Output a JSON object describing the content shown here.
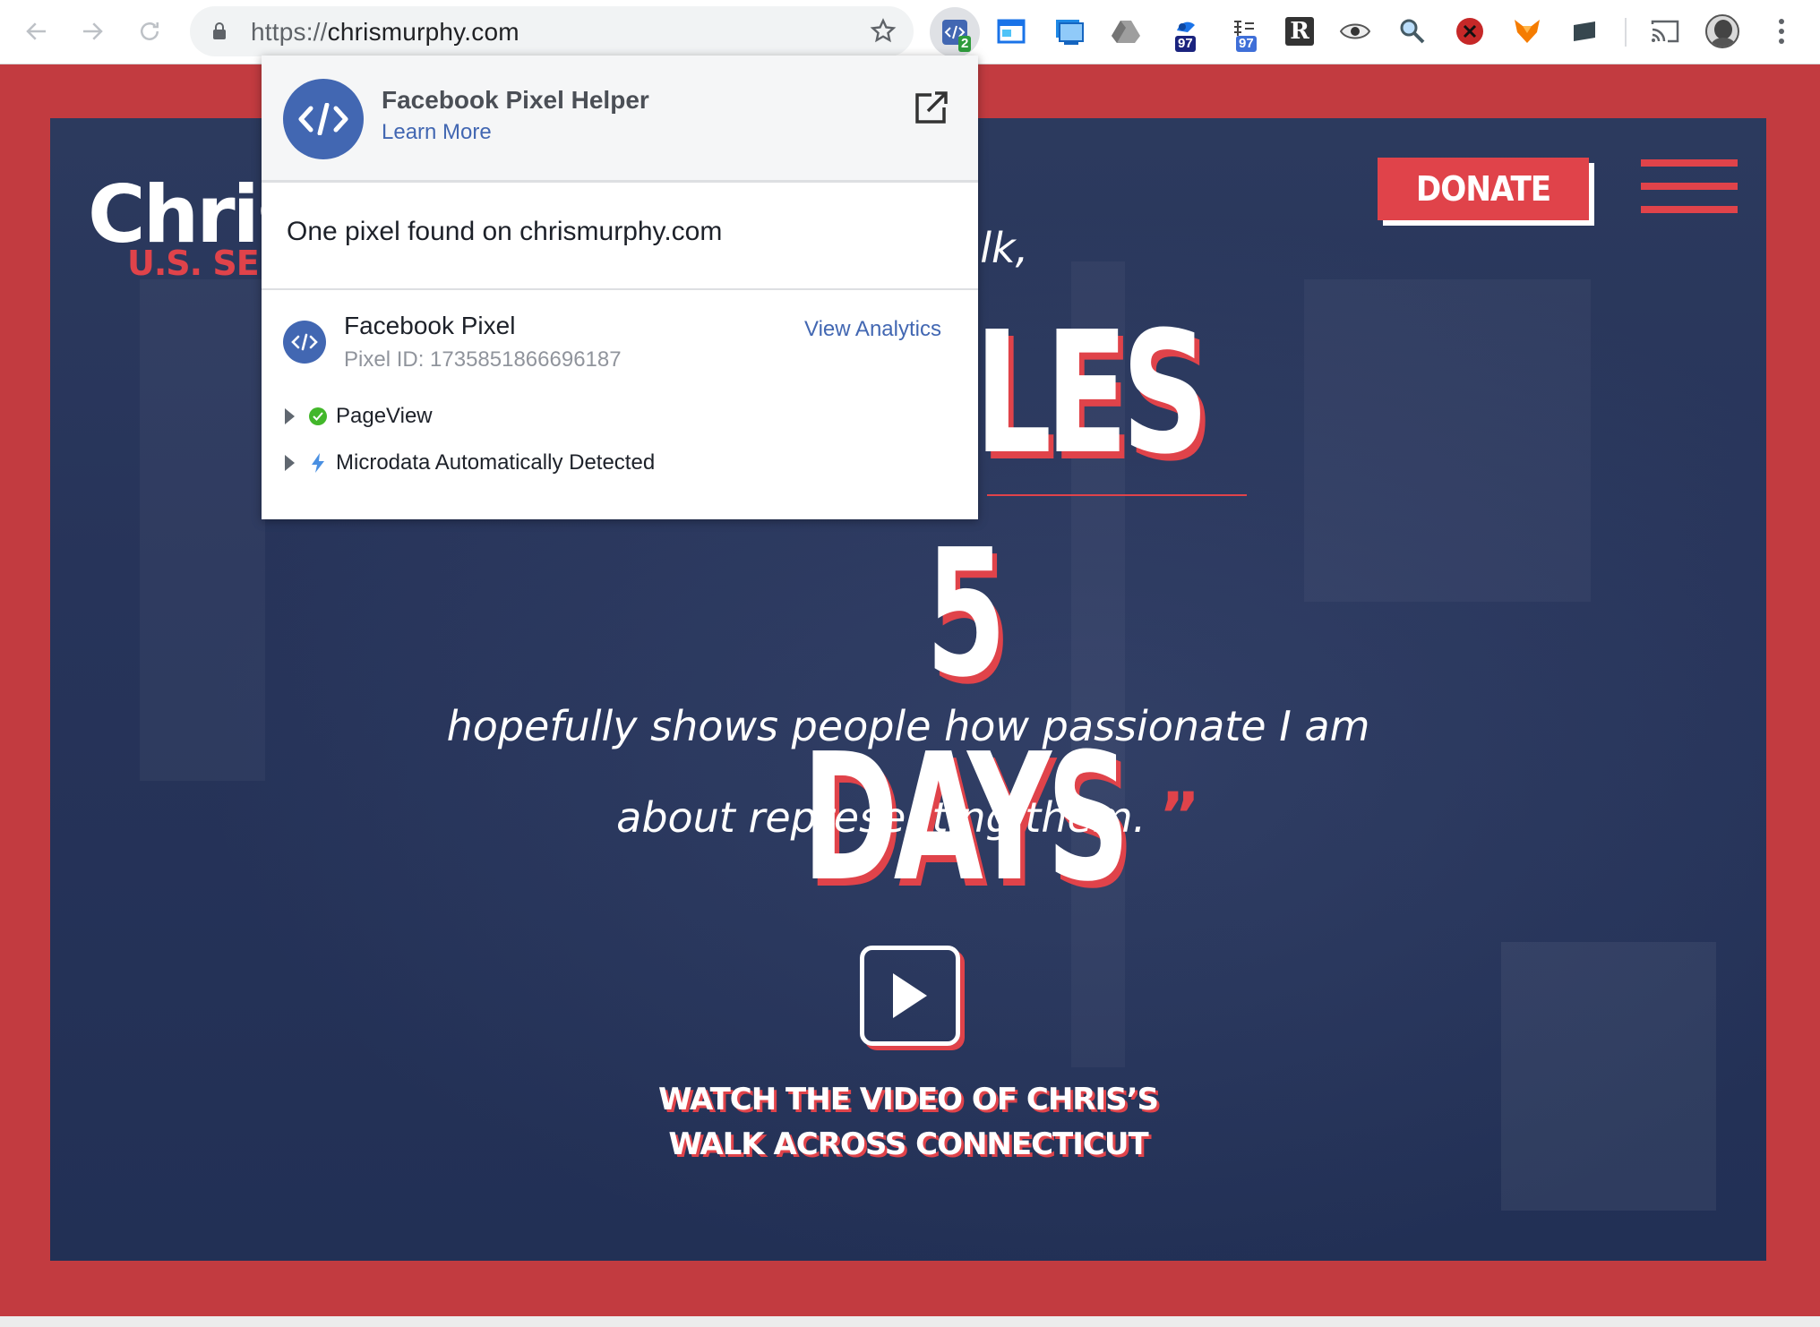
{
  "browser": {
    "url_scheme": "https://",
    "url_host": "chrismurphy.com",
    "extensions": [
      {
        "name": "facebook-pixel-helper-icon",
        "badge": "2",
        "active": true
      },
      {
        "name": "window-extension-icon"
      },
      {
        "name": "screenshot-extension-icon"
      },
      {
        "name": "drive-extension-icon"
      },
      {
        "name": "drop-extension-icon",
        "badge": "97"
      },
      {
        "name": "tree-extension-icon",
        "badge": "97"
      },
      {
        "name": "r-extension-icon",
        "label": "R"
      },
      {
        "name": "eye-extension-icon"
      },
      {
        "name": "search-bug-extension-icon"
      },
      {
        "name": "blocker-extension-icon"
      },
      {
        "name": "fox-extension-icon"
      },
      {
        "name": "screen-extension-icon"
      },
      {
        "name": "cast-icon"
      },
      {
        "name": "profile-avatar"
      }
    ]
  },
  "site": {
    "logo_name": "Chris",
    "logo_sub": "U.S. SENA",
    "donate_label": "DONATE",
    "quote_fragment": "alk,",
    "big_fragment": "LES",
    "days_text": "5 DAYS",
    "quote_line1": "hopefully shows people how passionate I am",
    "quote_line2": "about representing them.",
    "close_quote": "”",
    "cta_line1": "WATCH THE VIDEO OF CHRIS’S",
    "cta_line2": "WALK ACROSS CONNECTICUT"
  },
  "popup": {
    "title": "Facebook Pixel Helper",
    "learn_more": "Learn More",
    "found_text": "One pixel found on chrismurphy.com",
    "pixel_name": "Facebook Pixel",
    "pixel_id": "Pixel ID: 1735851866696187",
    "view_analytics": "View Analytics",
    "events": [
      {
        "label": "PageView",
        "status": "success"
      },
      {
        "label": "Microdata Automatically Detected",
        "status": "info"
      }
    ]
  },
  "colors": {
    "brand_red": "#e0434a",
    "navy": "#27345a",
    "facebook_blue": "#4267b2"
  }
}
